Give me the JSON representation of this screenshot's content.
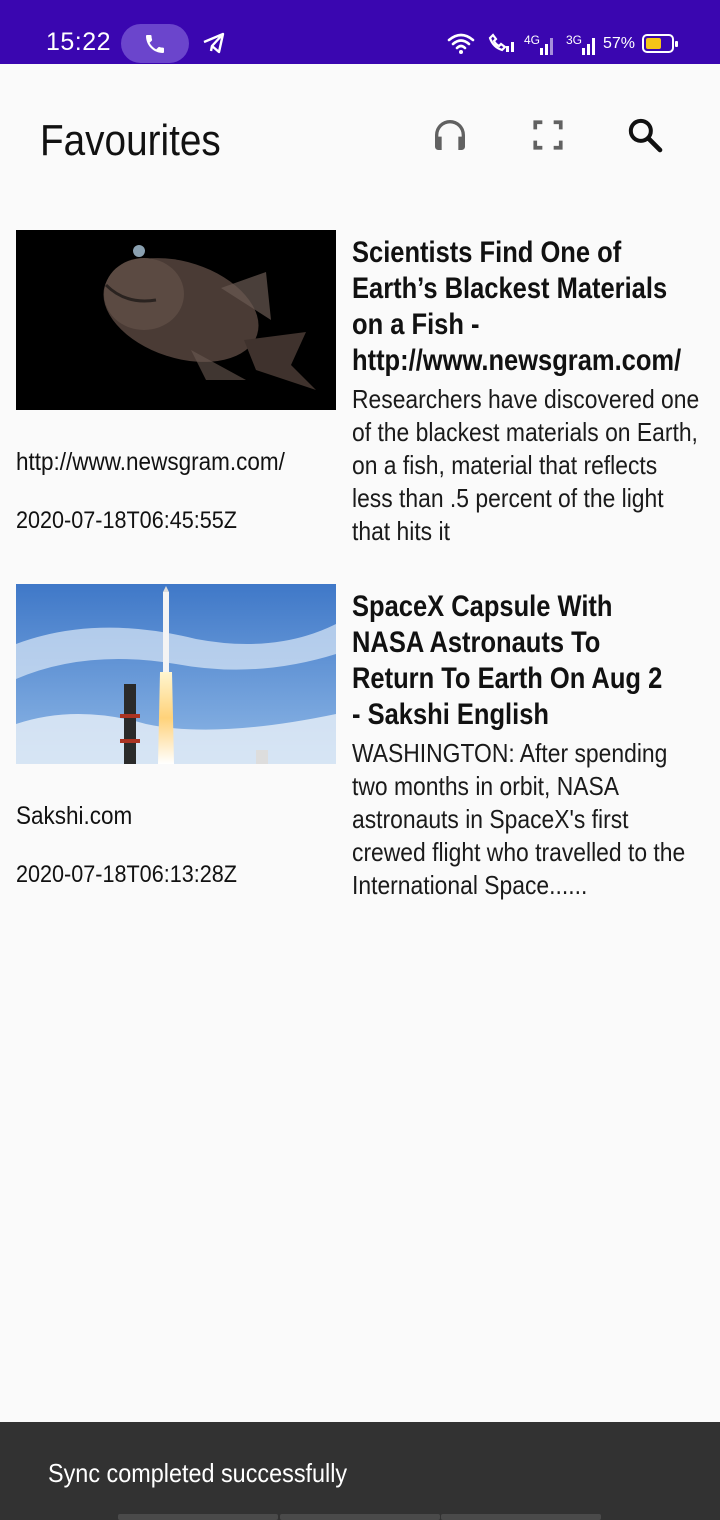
{
  "status_bar": {
    "time": "15:22",
    "battery": "57%",
    "icons": [
      "phone-icon",
      "telegram-icon",
      "wifi-icon",
      "wifi-call-icon",
      "signal-4g-icon",
      "signal-3g-icon",
      "battery-icon"
    ],
    "network_4g": "4G",
    "network_3g": "3G"
  },
  "app_bar": {
    "title": "Favourites",
    "actions": [
      "headphones-icon",
      "fullscreen-icon",
      "search-icon"
    ]
  },
  "articles": [
    {
      "title": "Scientists Find One of Earth’s Blackest Materials on a Fish - http://www.newsgram.com/",
      "description": "Researchers have discovered one of the blackest materials on Earth, on a fish, material that reflects less than .5 percent of the light that hits it",
      "source": "http://www.newsgram.com/",
      "date": "2020-07-18T06:45:55Z",
      "image": "fish-image"
    },
    {
      "title": "SpaceX Capsule With NASA Astronauts To Return To Earth On Aug 2 - Sakshi English",
      "description": "WASHINGTON: After spending two months in orbit, NASA astronauts in SpaceX's first crewed flight who travelled to the International Space......",
      "source": "Sakshi.com",
      "date": "2020-07-18T06:13:28Z",
      "image": "rocket-image"
    }
  ],
  "snackbar": {
    "message": "Sync completed successfully"
  },
  "colors": {
    "status_bar": "#3a06b0",
    "background": "#fafafa",
    "snackbar": "#323232"
  }
}
